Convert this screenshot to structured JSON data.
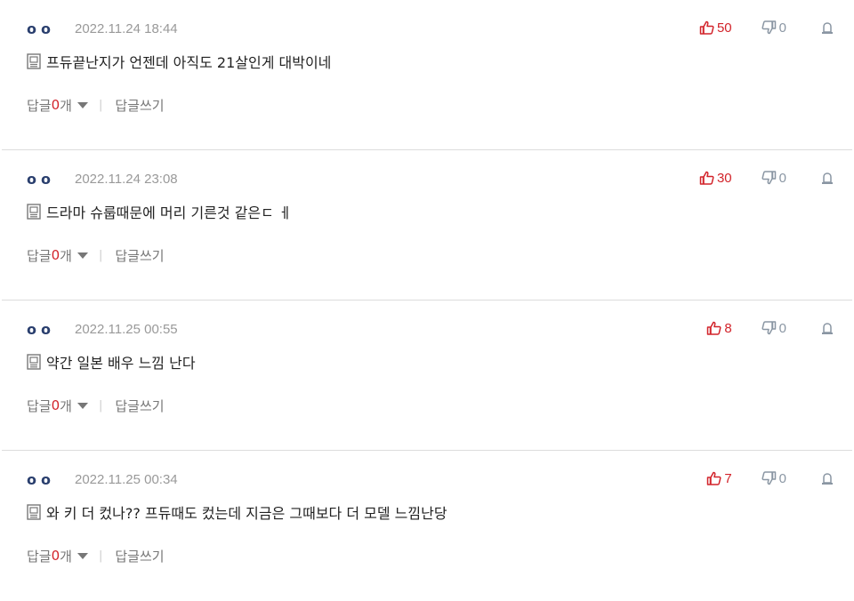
{
  "comments": [
    {
      "nickname": "oo",
      "date": "2022.11.24 18:44",
      "likes": "50",
      "dislikes": "0",
      "text": "프듀끝난지가 언젠데 아직도 21살인게 대박이네",
      "reply_label": "답글",
      "reply_count": "0",
      "reply_unit": "개",
      "write_reply_label": "답글쓰기"
    },
    {
      "nickname": "oo",
      "date": "2022.11.24 23:08",
      "likes": "30",
      "dislikes": "0",
      "text": "드라마 슈룹때문에 머리 기른것 같은ㄷ ㅔ",
      "reply_label": "답글",
      "reply_count": "0",
      "reply_unit": "개",
      "write_reply_label": "답글쓰기"
    },
    {
      "nickname": "oo",
      "date": "2022.11.25 00:55",
      "likes": "8",
      "dislikes": "0",
      "text": "약간 일본 배우 느낌 난다",
      "reply_label": "답글",
      "reply_count": "0",
      "reply_unit": "개",
      "write_reply_label": "답글쓰기"
    },
    {
      "nickname": "oo",
      "date": "2022.11.25 00:34",
      "likes": "7",
      "dislikes": "0",
      "text": "와 키 더 컸나?? 프듀때도 컸는데 지금은 그때보다 더 모델 느낌난당",
      "reply_label": "답글",
      "reply_count": "0",
      "reply_unit": "개",
      "write_reply_label": "답글쓰기"
    }
  ],
  "colors": {
    "like": "#d2232a",
    "dislike": "#8a96a3",
    "nickname": "#2a3f6e",
    "date": "#999999",
    "divider": "#dcdcdc"
  },
  "icons": {
    "like": "thumbs-up-icon",
    "dislike": "thumbs-down-icon",
    "report": "report-icon",
    "memo": "memo-icon",
    "expand": "caret-down-icon"
  }
}
